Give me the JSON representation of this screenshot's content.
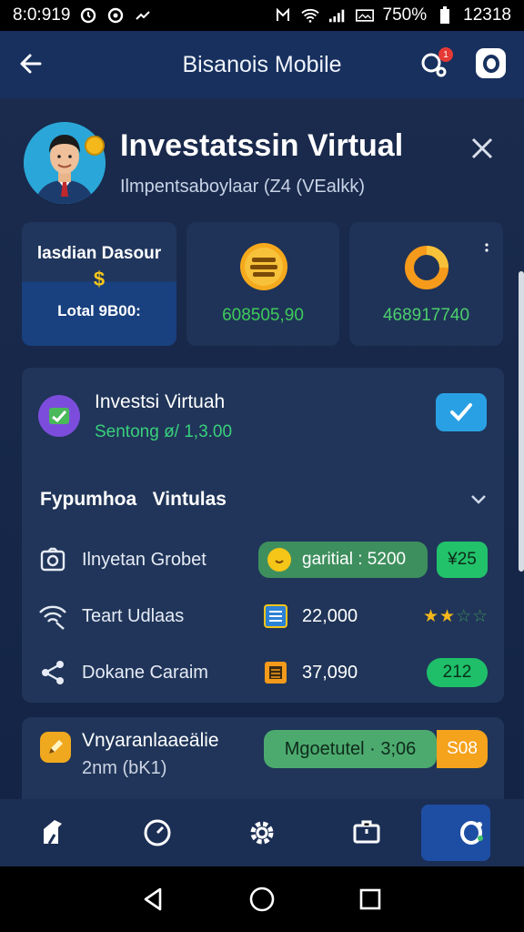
{
  "status_bar": {
    "time": "8:0:919",
    "battery": "750%",
    "clock": "12318"
  },
  "app_bar": {
    "title": "Bisanois Mobile",
    "notification_count": "1"
  },
  "header": {
    "title": "Investatssin Virtual",
    "subtitle": "Ilmpentsaboylaar (Z4 (VEalkk)"
  },
  "stat_cards": [
    {
      "title": "lasdian Dasour",
      "symbol": "$",
      "total": "Lotal 9B00:"
    },
    {
      "value": "608505,90",
      "icon": "coin-stack-icon"
    },
    {
      "value": "468917740",
      "icon": "ring-icon"
    }
  ],
  "investment": {
    "title": "Investsi Virtuah",
    "subtitle": "Sentong ø/ 1,3.00"
  },
  "section": {
    "title": "Fypumhoa   Vintulas"
  },
  "rows": [
    {
      "label": "Ilnyetan Grobet",
      "pill": "garitial : 5200",
      "badge": "¥25"
    },
    {
      "label": "Teart Udlaas",
      "value": "22,000",
      "stars": "★★",
      "stars_faded": "☆☆"
    },
    {
      "label": "Dokane Caraim",
      "value": "37,090",
      "badge": "212"
    }
  ],
  "panel2": {
    "title": "Vnyaranlaaeälie",
    "subtitle": "2nm (bK1)",
    "pill": "Mgoetutel · 3;06",
    "badge": "S08"
  },
  "colors": {
    "accent_blue": "#2aa0e4",
    "green": "#22c26b",
    "orange": "#f5a21c",
    "gold": "#f5c518",
    "bg": "#132446"
  }
}
